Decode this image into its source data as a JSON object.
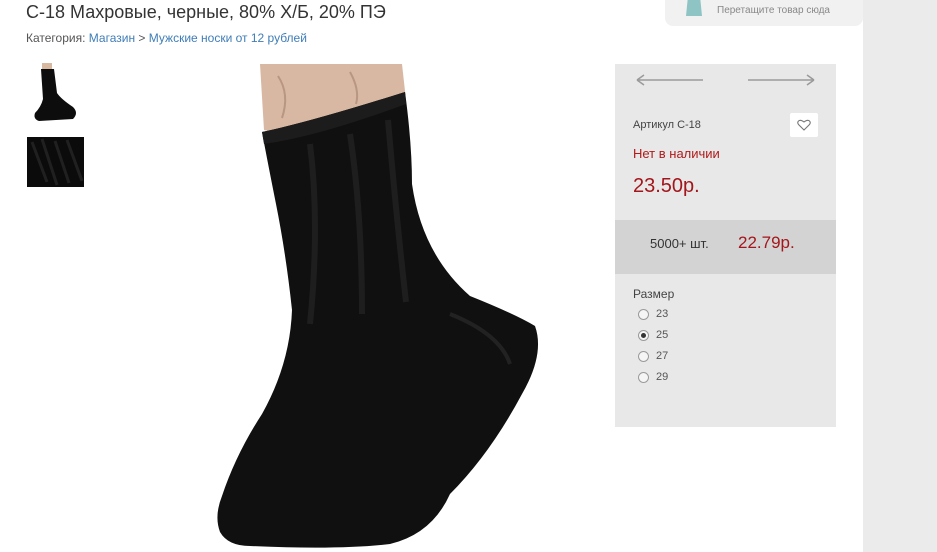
{
  "product": {
    "title": "С-18 Махровые, черные, 80% Х/Б, 20% ПЭ",
    "breadcrumb": {
      "prefix": "Категория:",
      "items": [
        "Магазин",
        "Мужские носки от 12 рублей"
      ],
      "separator": ">"
    }
  },
  "cart_widget": {
    "hint": "Перетащите товар сюда"
  },
  "panel": {
    "sku": "Артикул С-18",
    "stock_status": "Нет в наличии",
    "price": "23.50р.",
    "bulk": {
      "quantity": "5000+ шт.",
      "price": "22.79р."
    },
    "size_label": "Размер",
    "sizes": [
      {
        "label": "23",
        "selected": false
      },
      {
        "label": "25",
        "selected": true
      },
      {
        "label": "27",
        "selected": false
      },
      {
        "label": "29",
        "selected": false
      }
    ]
  },
  "colors": {
    "link": "#3f7db8",
    "price_red": "#a3161b",
    "panel_bg": "#e8e8e8",
    "bulk_bg": "#d3d3d3"
  },
  "icons": [
    "shopping-bag-icon",
    "arrow-left-icon",
    "arrow-right-icon",
    "heart-icon"
  ]
}
